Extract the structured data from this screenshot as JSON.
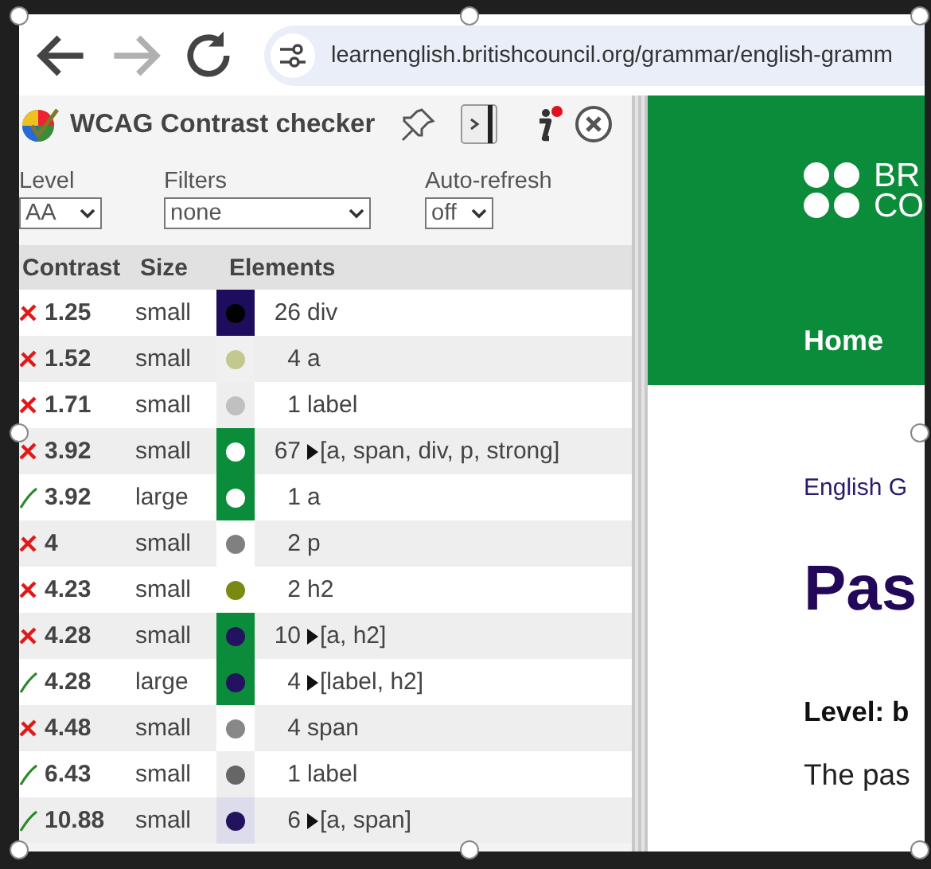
{
  "browser": {
    "forward": {
      "disabled": true
    },
    "url": "learnenglish.britishcouncil.org/grammar/english-gramm"
  },
  "panel": {
    "title": "WCAG Contrast checker",
    "info": {
      "has_notification": true
    },
    "controls": [
      {
        "label": "Level",
        "value": "AA"
      },
      {
        "label": "Filters",
        "value": "none"
      },
      {
        "label": "Auto-refresh",
        "value": "off"
      }
    ],
    "columns": [
      "Contrast",
      "Size",
      "Elements"
    ],
    "rows": [
      {
        "passed": false,
        "contrast": "1.25",
        "size": "small",
        "swatch": {
          "color": "#1e0d5c"
        },
        "dot": {
          "color": "#000000"
        },
        "count": "26",
        "elements": "div",
        "expandable": false
      },
      {
        "passed": false,
        "contrast": "1.52",
        "size": "small",
        "swatch": {
          "color": "#f0f0f0"
        },
        "dot": {
          "color": "#c3c88e"
        },
        "count": "4",
        "elements": "a",
        "expandable": false
      },
      {
        "passed": false,
        "contrast": "1.71",
        "size": "small",
        "swatch": {
          "color": "#eeeeee"
        },
        "dot": {
          "color": "#c0c0c0"
        },
        "count": "1",
        "elements": "label",
        "expandable": false
      },
      {
        "passed": false,
        "contrast": "3.92",
        "size": "small",
        "swatch": {
          "color": "#0b8c3a"
        },
        "dot": {
          "color": "#ffffff"
        },
        "count": "67",
        "elements": "[a, span, div, p, strong]",
        "expandable": true
      },
      {
        "passed": true,
        "contrast": "3.92",
        "size": "large",
        "swatch": {
          "color": "#0b8c3a"
        },
        "dot": {
          "color": "#ffffff"
        },
        "count": "1",
        "elements": "a",
        "expandable": false
      },
      {
        "passed": false,
        "contrast": "4",
        "size": "small",
        "swatch": {
          "color": "#ffffff"
        },
        "dot": {
          "color": "#808080"
        },
        "count": "2",
        "elements": "p",
        "expandable": false
      },
      {
        "passed": false,
        "contrast": "4.23",
        "size": "small",
        "swatch": {
          "color": "#ffffff"
        },
        "dot": {
          "color": "#7a8a10"
        },
        "count": "2",
        "elements": "h2",
        "expandable": false
      },
      {
        "passed": false,
        "contrast": "4.28",
        "size": "small",
        "swatch": {
          "color": "#0b8c3a"
        },
        "dot": {
          "color": "#23135f"
        },
        "count": "10",
        "elements": "[a, h2]",
        "expandable": true
      },
      {
        "passed": true,
        "contrast": "4.28",
        "size": "large",
        "swatch": {
          "color": "#0b8c3a"
        },
        "dot": {
          "color": "#23135f"
        },
        "count": "4",
        "elements": "[label, h2]",
        "expandable": true
      },
      {
        "passed": false,
        "contrast": "4.48",
        "size": "small",
        "swatch": {
          "color": "#ffffff"
        },
        "dot": {
          "color": "#888888"
        },
        "count": "4",
        "elements": "span",
        "expandable": false
      },
      {
        "passed": true,
        "contrast": "6.43",
        "size": "small",
        "swatch": {
          "color": "#eeeeee"
        },
        "dot": {
          "color": "#666666"
        },
        "count": "1",
        "elements": "label",
        "expandable": false
      },
      {
        "passed": true,
        "contrast": "10.88",
        "size": "small",
        "swatch": {
          "color": "#dcdcec"
        },
        "dot": {
          "color": "#23135f"
        },
        "count": "6",
        "elements": "[a, span]",
        "expandable": true
      }
    ]
  },
  "page": {
    "logo_lines": [
      "BR",
      "CO"
    ],
    "nav": [
      "Home"
    ],
    "breadcrumb": "English G",
    "heading": "Pas",
    "level": "Level: b",
    "text": "The pas"
  }
}
